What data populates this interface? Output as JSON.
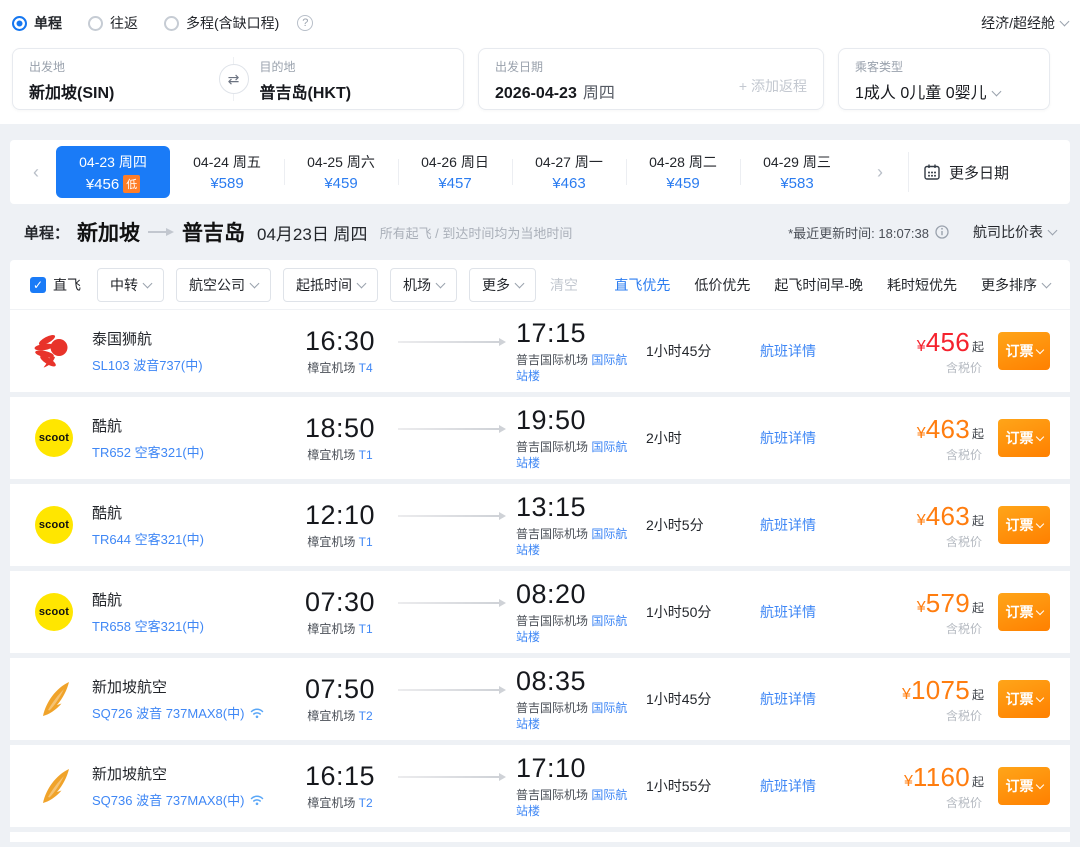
{
  "trip_type": {
    "options": [
      {
        "label": "单程",
        "selected": true
      },
      {
        "label": "往返",
        "selected": false
      },
      {
        "label": "多程(含缺口程)",
        "selected": false
      }
    ]
  },
  "cabin_selector": "经济/超经舱",
  "search": {
    "from_label": "出发地",
    "from_value": "新加坡(SIN)",
    "to_label": "目的地",
    "to_value": "普吉岛(HKT)",
    "date_label": "出发日期",
    "date_value": "2026-04-23",
    "date_weekday": "周四",
    "add_return": "+ 添加返程",
    "pax_label": "乘客类型",
    "pax_value": "1成人  0儿童  0婴儿"
  },
  "date_strip": {
    "tabs": [
      {
        "date": "04-23 周四",
        "price": "¥456",
        "badge": "低",
        "selected": true
      },
      {
        "date": "04-24 周五",
        "price": "¥589",
        "selected": false
      },
      {
        "date": "04-25 周六",
        "price": "¥459",
        "selected": false
      },
      {
        "date": "04-26 周日",
        "price": "¥457",
        "selected": false
      },
      {
        "date": "04-27 周一",
        "price": "¥463",
        "selected": false
      },
      {
        "date": "04-28 周二",
        "price": "¥459",
        "selected": false
      },
      {
        "date": "04-29 周三",
        "price": "¥583",
        "selected": false
      }
    ],
    "more_dates": "更多日期"
  },
  "route_header": {
    "trip_label": "单程：",
    "from": "新加坡",
    "to": "普吉岛",
    "date": "04月23日 周四",
    "note": "所有起飞 / 到达时间均为当地时间",
    "updated": "*最近更新时间: 18:07:38",
    "compare": "航司比价表"
  },
  "filters": {
    "direct": "直飞",
    "dropdowns": [
      "中转",
      "航空公司",
      "起抵时间",
      "机场",
      "更多"
    ],
    "clear": "清空",
    "sorts": [
      {
        "label": "直飞优先",
        "active": true
      },
      {
        "label": "低价优先",
        "active": false
      },
      {
        "label": "起飞时间早-晚",
        "active": false
      },
      {
        "label": "耗时短优先",
        "active": false
      },
      {
        "label": "更多排序",
        "active": false,
        "chevron": true
      }
    ]
  },
  "labels": {
    "details": "航班详情",
    "currency": "¥",
    "from_suffix": "起",
    "tax_note": "含税价",
    "book": "订票"
  },
  "flights": [
    {
      "airline": "泰国狮航",
      "logo": "lion",
      "code_line": "SL103 波音737(中)",
      "wifi": false,
      "dep_time": "16:30",
      "dep_airport": "樟宜机场",
      "dep_terminal": "T4",
      "arr_time": "17:15",
      "arr_airport": "普吉国际机场",
      "arr_terminal": "国际航站楼",
      "duration": "1小时45分",
      "price": "456",
      "lowest": true
    },
    {
      "airline": "酷航",
      "logo": "scoot",
      "code_line": "TR652 空客321(中)",
      "wifi": false,
      "dep_time": "18:50",
      "dep_airport": "樟宜机场",
      "dep_terminal": "T1",
      "arr_time": "19:50",
      "arr_airport": "普吉国际机场",
      "arr_terminal": "国际航站楼",
      "duration": "2小时",
      "price": "463",
      "lowest": false
    },
    {
      "airline": "酷航",
      "logo": "scoot",
      "code_line": "TR644 空客321(中)",
      "wifi": false,
      "dep_time": "12:10",
      "dep_airport": "樟宜机场",
      "dep_terminal": "T1",
      "arr_time": "13:15",
      "arr_airport": "普吉国际机场",
      "arr_terminal": "国际航站楼",
      "duration": "2小时5分",
      "price": "463",
      "lowest": false
    },
    {
      "airline": "酷航",
      "logo": "scoot",
      "code_line": "TR658 空客321(中)",
      "wifi": false,
      "dep_time": "07:30",
      "dep_airport": "樟宜机场",
      "dep_terminal": "T1",
      "arr_time": "08:20",
      "arr_airport": "普吉国际机场",
      "arr_terminal": "国际航站楼",
      "duration": "1小时50分",
      "price": "579",
      "lowest": false
    },
    {
      "airline": "新加坡航空",
      "logo": "sq",
      "code_line": "SQ726 波音 737MAX8(中)",
      "wifi": true,
      "dep_time": "07:50",
      "dep_airport": "樟宜机场",
      "dep_terminal": "T2",
      "arr_time": "08:35",
      "arr_airport": "普吉国际机场",
      "arr_terminal": "国际航站楼",
      "duration": "1小时45分",
      "price": "1075",
      "lowest": false
    },
    {
      "airline": "新加坡航空",
      "logo": "sq",
      "code_line": "SQ736 波音 737MAX8(中)",
      "wifi": true,
      "dep_time": "16:15",
      "dep_airport": "樟宜机场",
      "dep_terminal": "T2",
      "arr_time": "17:10",
      "arr_airport": "普吉国际机场",
      "arr_terminal": "国际航站楼",
      "duration": "1小时55分",
      "price": "1160",
      "lowest": false
    }
  ],
  "colors": {
    "accent_blue": "#1a7bf7",
    "link_blue": "#3f87f5",
    "price_orange": "#ff7d0f",
    "price_red": "#f5222d",
    "badge_orange": "#ff7d27",
    "scoot_yellow": "#ffe600",
    "lion_red": "#e8332a",
    "sq_gold": "#f0a32a"
  }
}
